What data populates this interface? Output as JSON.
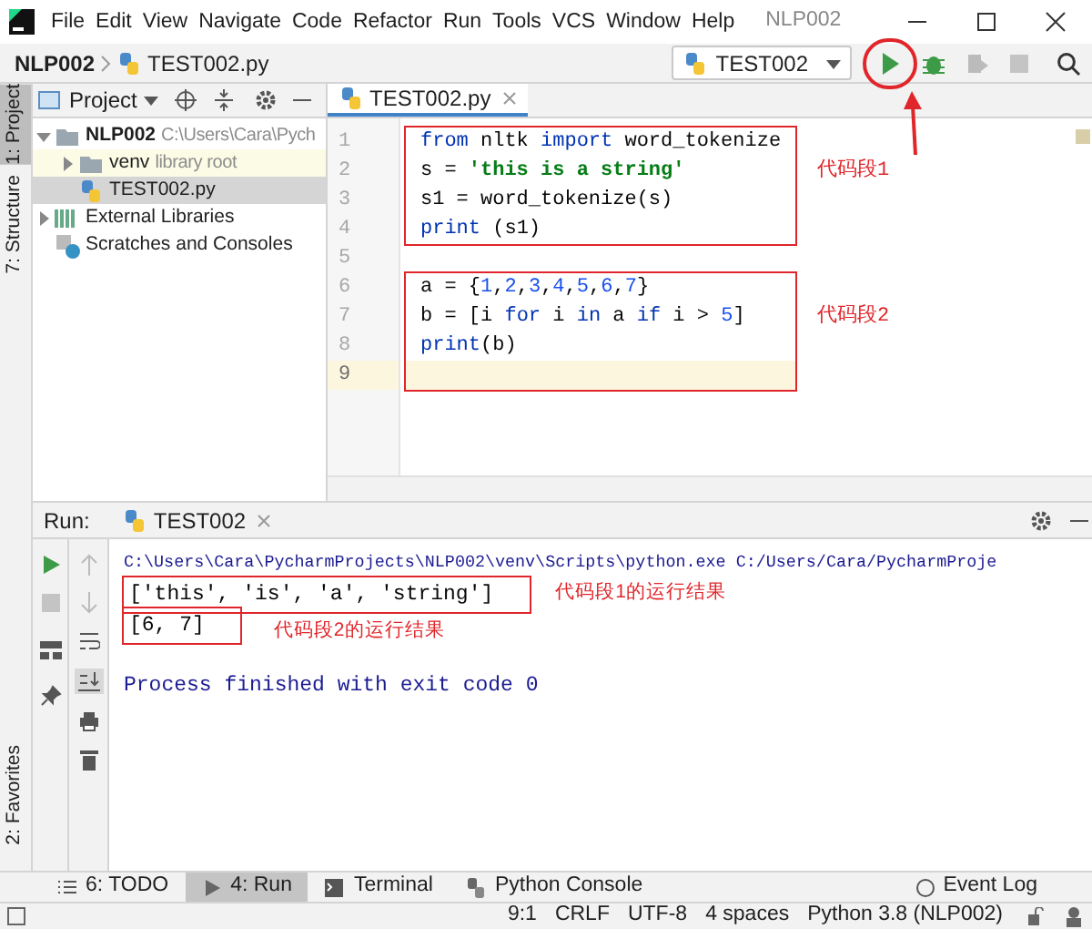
{
  "menu": [
    "File",
    "Edit",
    "View",
    "Navigate",
    "Code",
    "Refactor",
    "Run",
    "Tools",
    "VCS",
    "Window",
    "Help"
  ],
  "window": {
    "title": "NLP002"
  },
  "breadcrumb": [
    "NLP002",
    "TEST002.py"
  ],
  "toolbar": {
    "run_config": "TEST002",
    "run_circled": true
  },
  "side_tabs": [
    {
      "label": "1: Project",
      "selected": true
    },
    {
      "label": "7: Structure",
      "selected": false
    }
  ],
  "side_tabs_bottom": [
    {
      "label": "2: Favorites",
      "selected": false
    }
  ],
  "project_panel": {
    "title": "Project",
    "tree": [
      {
        "name": "NLP002",
        "hint": "C:\\Users\\Cara\\Pych",
        "kind": "folder",
        "expanded": true,
        "selected": false,
        "children": [
          {
            "name": "venv",
            "hint": "library root",
            "kind": "library",
            "expanded": false,
            "selected": false
          },
          {
            "name": "TEST002.py",
            "kind": "python",
            "selected": true
          }
        ]
      },
      {
        "name": "External Libraries",
        "kind": "libraries",
        "expanded": false,
        "selected": false
      },
      {
        "name": "Scratches and Consoles",
        "kind": "scratches",
        "selected": false
      }
    ]
  },
  "editor": {
    "tab": "TEST002.py",
    "blocks": [
      {
        "annotation": "代码段1",
        "lines": [
          {
            "number": "1",
            "current": false,
            "tokens": [
              {
                "kind": "keyword",
                "text": "from"
              },
              {
                "kind": "plain",
                "text": " nltk "
              },
              {
                "kind": "keyword",
                "text": "import"
              },
              {
                "kind": "plain",
                "text": " word_tokenize"
              }
            ]
          },
          {
            "number": "2",
            "current": false,
            "tokens": [
              {
                "kind": "plain",
                "text": "s = "
              },
              {
                "kind": "string",
                "text": "'this is a string'"
              }
            ]
          },
          {
            "number": "3",
            "current": false,
            "tokens": [
              {
                "kind": "plain",
                "text": "s1 = word_tokenize(s)"
              }
            ]
          },
          {
            "number": "4",
            "current": false,
            "tokens": [
              {
                "kind": "keyword",
                "text": "print"
              },
              {
                "kind": "plain",
                "text": " (s1)"
              }
            ]
          }
        ]
      },
      {
        "lines": [
          {
            "number": "5",
            "current": false
          }
        ]
      },
      {
        "annotation": "代码段2",
        "lines": [
          {
            "number": "6",
            "current": false,
            "tokens": [
              {
                "kind": "plain",
                "text": "a = {"
              },
              {
                "kind": "number",
                "text": "1"
              },
              {
                "kind": "plain",
                "text": ","
              },
              {
                "kind": "number",
                "text": "2"
              },
              {
                "kind": "plain",
                "text": ","
              },
              {
                "kind": "number",
                "text": "3"
              },
              {
                "kind": "plain",
                "text": ","
              },
              {
                "kind": "number",
                "text": "4"
              },
              {
                "kind": "plain",
                "text": ","
              },
              {
                "kind": "number",
                "text": "5"
              },
              {
                "kind": "plain",
                "text": ","
              },
              {
                "kind": "number",
                "text": "6"
              },
              {
                "kind": "plain",
                "text": ","
              },
              {
                "kind": "number",
                "text": "7"
              },
              {
                "kind": "plain",
                "text": "}"
              }
            ]
          },
          {
            "number": "7",
            "current": false,
            "tokens": [
              {
                "kind": "plain",
                "text": "b = [i "
              },
              {
                "kind": "keyword",
                "text": "for"
              },
              {
                "kind": "plain",
                "text": " i "
              },
              {
                "kind": "keyword",
                "text": "in"
              },
              {
                "kind": "plain",
                "text": " a "
              },
              {
                "kind": "keyword",
                "text": "if"
              },
              {
                "kind": "plain",
                "text": " i > "
              },
              {
                "kind": "number",
                "text": "5"
              },
              {
                "kind": "plain",
                "text": "]"
              }
            ]
          },
          {
            "number": "8",
            "current": false,
            "tokens": [
              {
                "kind": "keyword",
                "text": "print"
              },
              {
                "kind": "plain",
                "text": "(b)"
              }
            ]
          },
          {
            "number": "9",
            "current": true
          }
        ]
      }
    ]
  },
  "run_panel": {
    "label": "Run:",
    "tab": "TEST002",
    "output": [
      {
        "kind": "command",
        "text": "C:\\Users\\Cara\\PycharmProjects\\NLP002\\venv\\Scripts\\python.exe C:/Users/Cara/PycharmProje"
      },
      {
        "kind": "stdout",
        "text": "['this', 'is', 'a', 'string']",
        "annotation": "代码段1的运行结果"
      },
      {
        "kind": "stdout",
        "text": "[6, 7]",
        "annotation": "代码段2的运行结果"
      },
      {
        "kind": "blank"
      },
      {
        "kind": "system",
        "text": "Process finished with exit code 0"
      }
    ]
  },
  "bottom_tabs": [
    {
      "label": "6: TODO",
      "selected": false,
      "kind": "todo"
    },
    {
      "label": "4: Run",
      "selected": true,
      "kind": "run"
    },
    {
      "label": "Terminal",
      "selected": false,
      "kind": "terminal"
    },
    {
      "label": "Python Console",
      "selected": false,
      "kind": "console"
    }
  ],
  "event_log": "Event Log",
  "status_bar": [
    "9:1",
    "CRLF",
    "UTF-8",
    "4 spaces",
    "Python 3.8 (NLP002)"
  ]
}
